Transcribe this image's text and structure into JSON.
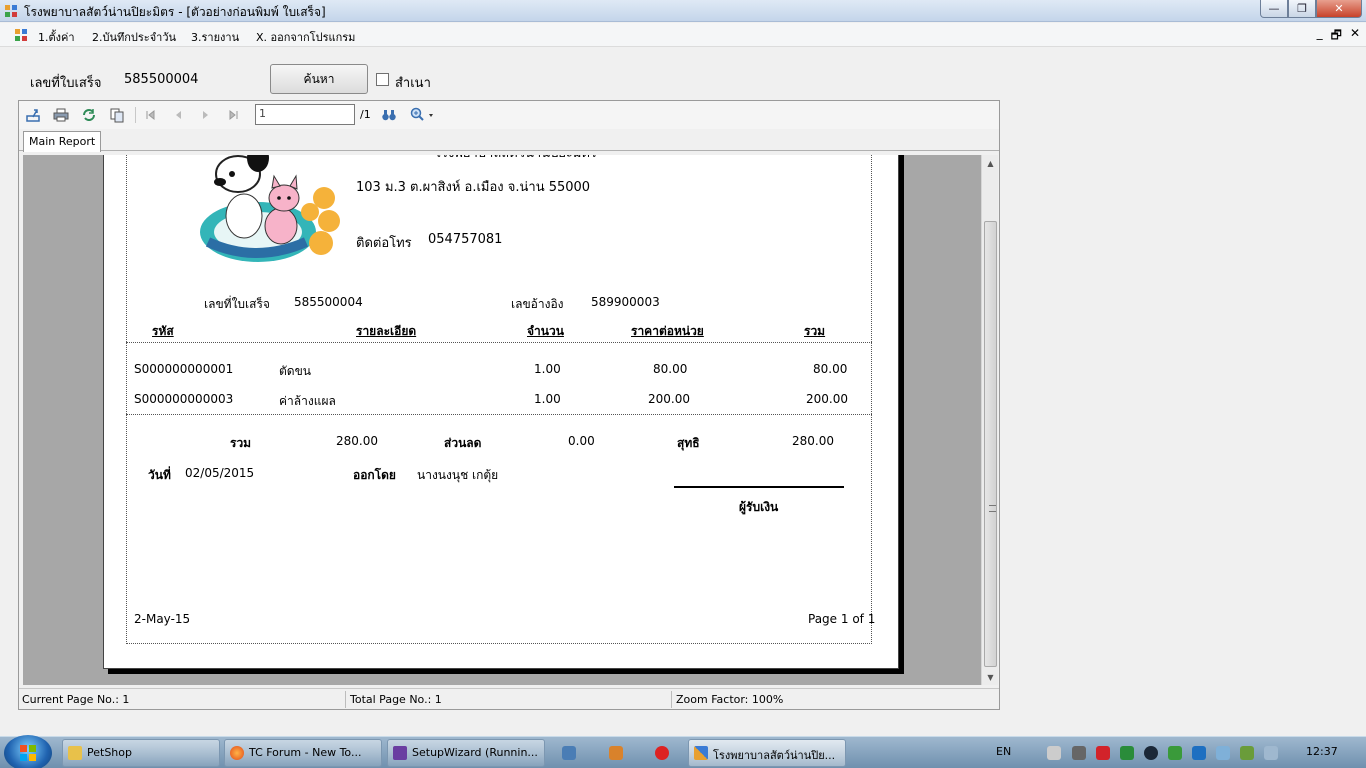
{
  "window": {
    "title": "โรงพยาบาลสัตว์น่านปิยะมิตร - [ตัวอย่างก่อนพิมพ์ ใบเสร็จ]",
    "buttons": {
      "minimize": "—",
      "maximize": "❐",
      "close": "✕"
    }
  },
  "menu": {
    "items": [
      "1.ตั้งค่า",
      "2.บันทึกประจำวัน",
      "3.รายงาน",
      "X. ออกจากโปรแกรม"
    ],
    "mdi": {
      "minimize": "_",
      "restore": "🗗",
      "close": "✕"
    }
  },
  "search": {
    "label": "เลขที่ใบเสร็จ",
    "value": "585500004",
    "button": "ค้นหา",
    "copy_label": "สำเนา"
  },
  "viewer": {
    "page_input": "1",
    "page_of": "/1",
    "tab": "Main Report",
    "status": {
      "current": "Current Page No.: 1",
      "total": "Total Page No.: 1",
      "zoom": "Zoom Factor: 100%"
    }
  },
  "report": {
    "header_title": "โรงพยาบาลสัตว์น่านปิยะมิตร",
    "address": "103 ม.3 ต.ผาสิงห์ อ.เมือง จ.น่าน 55000",
    "phone_label": "ติดต่อโทร",
    "phone": "054757081",
    "logo_text": "โรงพยาบาลสัตว์น่านปิยะมิตร",
    "receipt_label": "เลขที่ใบเสร็จ",
    "receipt_no": "585500004",
    "ref_label": "เลขอ้างอิง",
    "ref_no": "589900003",
    "columns": [
      "รหัส",
      "รายละเอียด",
      "จำนวน",
      "ราคาต่อหน่วย",
      "รวม"
    ],
    "rows": [
      {
        "code": "S000000000001",
        "detail": "ตัดขน",
        "qty": "1.00",
        "price": "80.00",
        "total": "80.00"
      },
      {
        "code": "S000000000003",
        "detail": "ค่าล้างแผล",
        "qty": "1.00",
        "price": "200.00",
        "total": "200.00"
      }
    ],
    "sum_label": "รวม",
    "sum_value": "280.00",
    "discount_label": "ส่วนลด",
    "discount_value": "0.00",
    "net_label": "สุทธิ",
    "net_value": "280.00",
    "date_label": "วันที่",
    "date_value": "02/05/2015",
    "issued_label": "ออกโดย",
    "issued_value": "นางนงนุช เกตุ้ย",
    "receiver_label": "ผู้รับเงิน",
    "print_date": "2-May-15",
    "page_info": "Page 1 of 1"
  },
  "taskbar": {
    "apps": [
      "PetShop",
      "TC Forum - New To...",
      "SetupWizard (Runnin...",
      "โรงพยาบาลสัตว์น่านปิย..."
    ],
    "lang": "EN",
    "clock": "12:37"
  }
}
